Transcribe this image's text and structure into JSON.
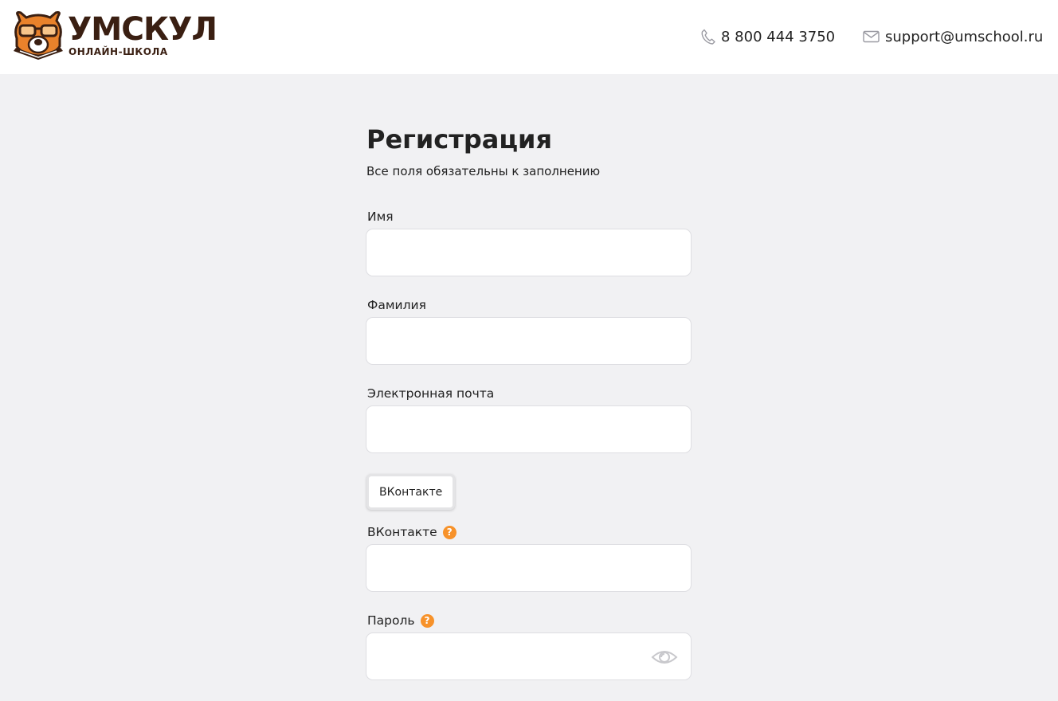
{
  "brand": {
    "name": "УМСКУЛ",
    "tagline": "ОНЛАЙН-ШКОЛА",
    "color": "#3a1f12",
    "accent": "#f7922a"
  },
  "header": {
    "phone": {
      "icon": "phone-icon",
      "text": "8 800 444 3750"
    },
    "email": {
      "icon": "mail-icon",
      "text": "support@umschool.ru"
    }
  },
  "form": {
    "title": "Регистрация",
    "subtitle": "Все поля обязательны к заполнению",
    "fields": {
      "first_name": {
        "label": "Имя",
        "value": ""
      },
      "last_name": {
        "label": "Фамилия",
        "value": ""
      },
      "email": {
        "label": "Электронная почта",
        "value": ""
      },
      "vk": {
        "label": "ВКонтакте",
        "value": "",
        "help_icon": "question-icon",
        "help_glyph": "?"
      },
      "password": {
        "label": "Пароль",
        "value": "",
        "help_icon": "question-icon",
        "help_glyph": "?",
        "toggle_icon": "eye-icon"
      }
    },
    "vk_button": {
      "label": "ВКонтакте"
    }
  }
}
